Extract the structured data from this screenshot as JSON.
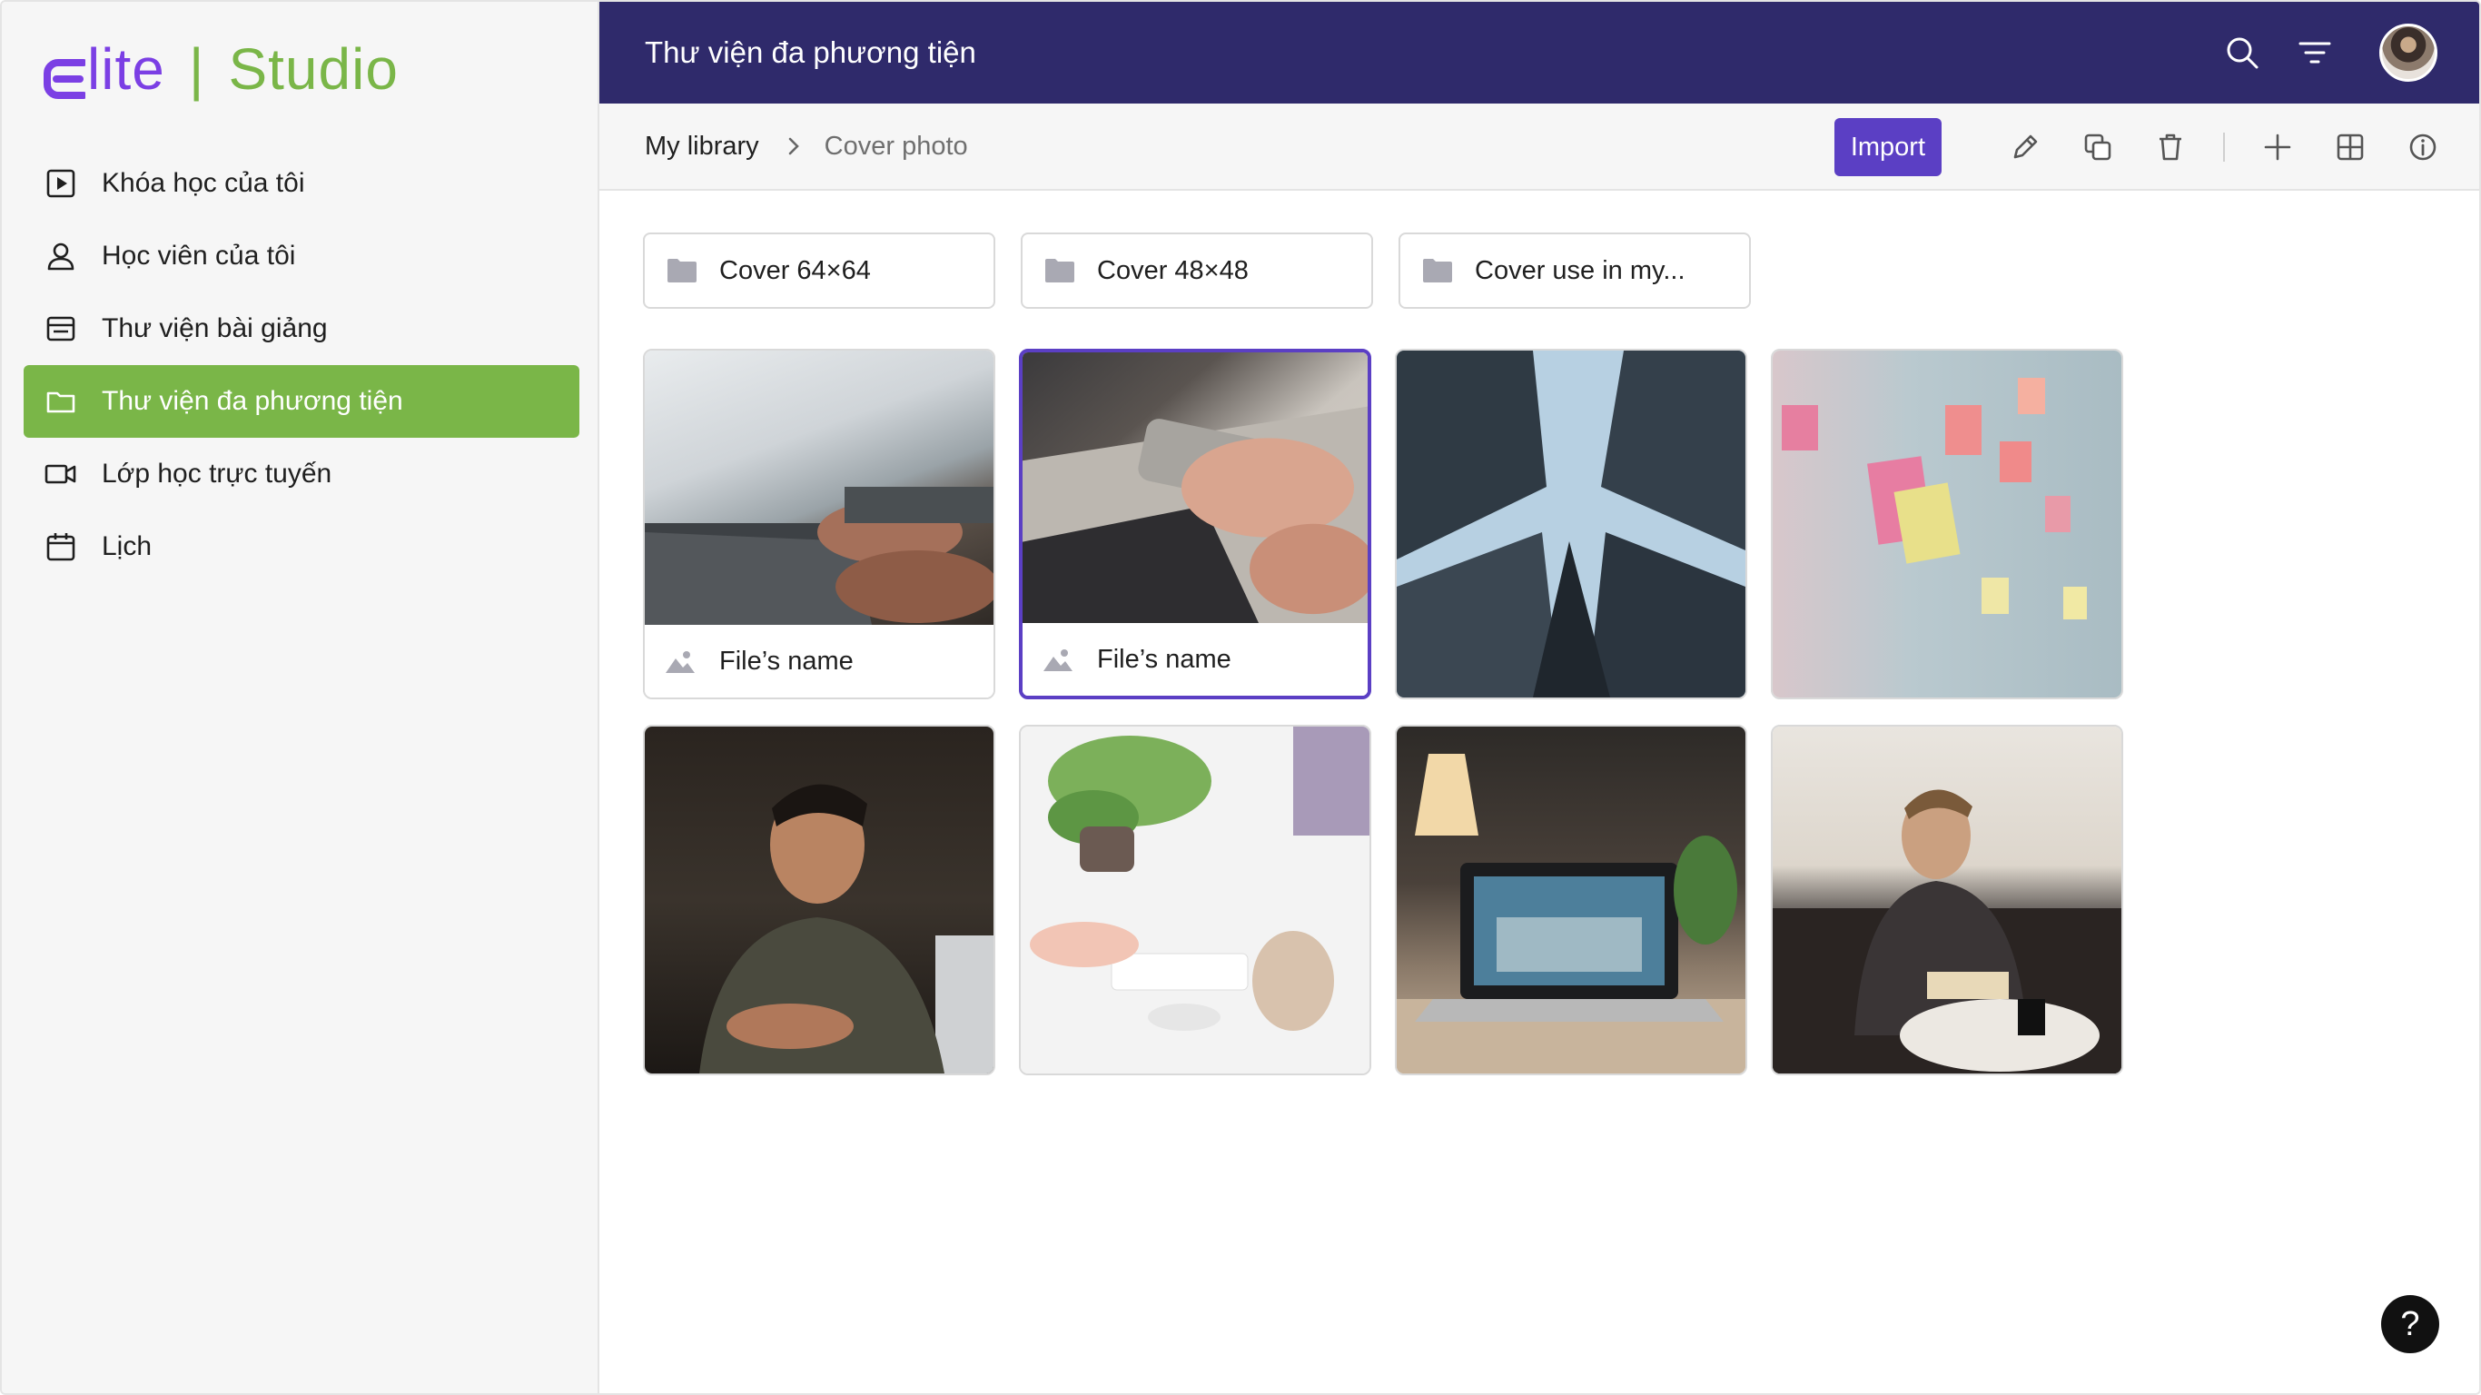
{
  "brand": {
    "logo_letter": "E",
    "logo_rest": "lite",
    "separator": "|",
    "studio": "Studio"
  },
  "sidebar": {
    "items": [
      {
        "label": "Khóa học của tôi",
        "icon": "play-square-icon",
        "active": false
      },
      {
        "label": "Học viên của tôi",
        "icon": "user-icon",
        "active": false
      },
      {
        "label": "Thư viện bài giảng",
        "icon": "list-box-icon",
        "active": false
      },
      {
        "label": "Thư viện đa phương tiện",
        "icon": "folder-icon",
        "active": true
      },
      {
        "label": "Lớp học trực tuyến",
        "icon": "video-camera-icon",
        "active": false
      },
      {
        "label": "Lịch",
        "icon": "calendar-icon",
        "active": false
      }
    ]
  },
  "header": {
    "title": "Thư viện đa phương tiện"
  },
  "breadcrumb": {
    "root": "My library",
    "current": "Cover photo"
  },
  "toolbar": {
    "import_label": "Import"
  },
  "folders": [
    {
      "label": "Cover 64×64"
    },
    {
      "label": "Cover 48×48"
    },
    {
      "label": "Cover use in my..."
    }
  ],
  "files": [
    {
      "name": "File’s name",
      "selected": false,
      "subject": "laptop-typing"
    },
    {
      "name": "File’s name",
      "selected": true,
      "subject": "phone-in-hand"
    },
    {
      "name": "",
      "selected": false,
      "subject": "skyscrapers"
    },
    {
      "name": "",
      "selected": false,
      "subject": "sticky-notes"
    },
    {
      "name": "",
      "selected": false,
      "subject": "man-with-phone"
    },
    {
      "name": "",
      "selected": false,
      "subject": "desk-plant-keyboard"
    },
    {
      "name": "",
      "selected": false,
      "subject": "desk-laptop-lamp"
    },
    {
      "name": "",
      "selected": false,
      "subject": "man-reading"
    }
  ],
  "help": {
    "label": "?"
  },
  "colors": {
    "accent_green": "#7ab648",
    "accent_purple": "#5b3fc4",
    "header_bg": "#2f2a6b"
  }
}
